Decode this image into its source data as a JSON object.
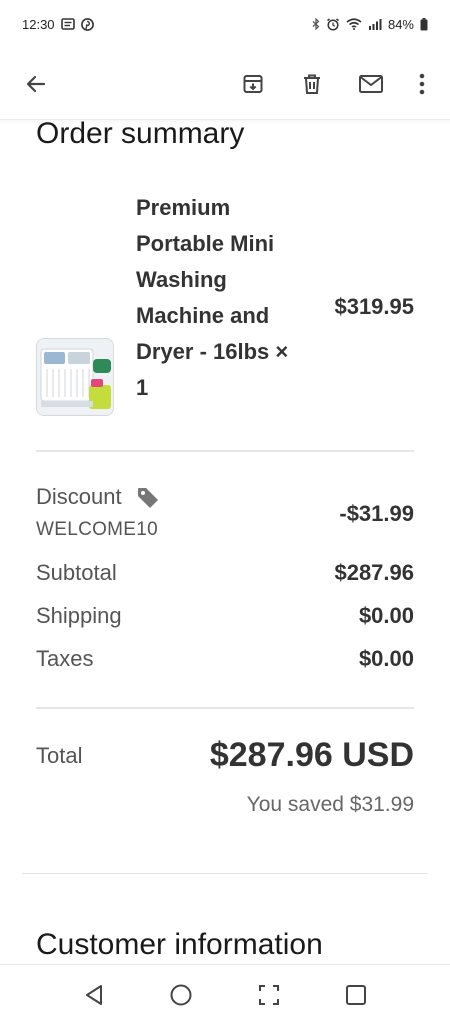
{
  "status_bar": {
    "time": "12:30",
    "battery": "84%"
  },
  "app_bar": {
    "back_icon": "arrow-left-icon",
    "actions": [
      "archive-icon",
      "delete-icon",
      "mail-icon",
      "more-vert-icon"
    ]
  },
  "order_summary": {
    "title": "Order summary",
    "product": {
      "name": "Premium Portable Mini Washing Machine and Dryer - 16lbs × 1",
      "price": "$319.95"
    },
    "discount": {
      "label": "Discount",
      "code": "WELCOME10",
      "value": "-$31.99"
    },
    "subtotal": {
      "label": "Subtotal",
      "value": "$287.96"
    },
    "shipping": {
      "label": "Shipping",
      "value": "$0.00"
    },
    "taxes": {
      "label": "Taxes",
      "value": "$0.00"
    },
    "total": {
      "label": "Total",
      "value": "$287.96 USD"
    },
    "saved": "You saved $31.99"
  },
  "customer_information": {
    "title": "Customer information"
  },
  "colors": {
    "text_dark": "#333333",
    "text_muted": "#555555",
    "divider": "#e6e6e6"
  }
}
